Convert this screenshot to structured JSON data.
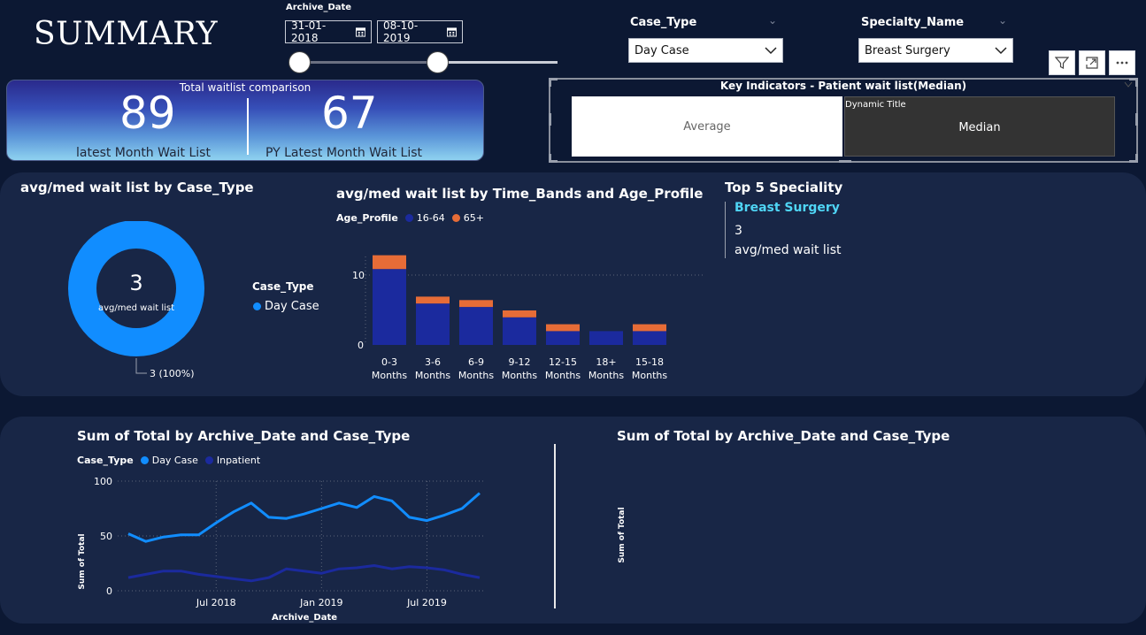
{
  "header": {
    "title": "SUMMARY",
    "archive_date_label": "Archive_Date",
    "date_start": "31-01-2018",
    "date_end": "08-10-2019",
    "case_type_label": "Case_Type",
    "case_type_value": "Day Case",
    "specialty_label": "Specialty_Name",
    "specialty_value": "Breast Surgery"
  },
  "kpi": {
    "title": "Total waitlist comparison",
    "latest_value": "89",
    "latest_label": "latest Month Wait List",
    "py_value": "67",
    "py_label": "PY Latest Month Wait List"
  },
  "key_indicators": {
    "title": "Key Indicators - Patient wait list(Median)",
    "average_label": "Average",
    "dynamic_title": "Dynamic Title",
    "median_label": "Median"
  },
  "donut": {
    "title": "avg/med wait list by Case_Type",
    "center_value": "3",
    "center_label": "avg/med wait list",
    "data_label": "3 (100%)",
    "legend_title": "Case_Type",
    "legend_item": "Day Case",
    "color": "#118dff"
  },
  "bar_chart": {
    "title": "avg/med wait list by Time_Bands and Age_Profile",
    "legend_title": "Age_Profile",
    "tick_0": "0",
    "tick_10": "10"
  },
  "top5": {
    "title": "Top 5 Speciality",
    "item_name": "Breast Surgery",
    "item_value": "3",
    "item_metric": "avg/med wait list"
  },
  "line_chart": {
    "title": "Sum of Total by Archive_Date and Case_Type",
    "legend_title": "Case_Type",
    "ylabel": "Sum of Total",
    "xlabel": "Archive_Date",
    "y_ticks": [
      "100",
      "50",
      "0"
    ],
    "x_ticks": [
      "Jul 2018",
      "Jan 2019",
      "Jul 2019"
    ]
  },
  "line_chart_2": {
    "title": "Sum of Total by Archive_Date and Case_Type",
    "ylabel": "Sum of Total"
  },
  "chart_data": [
    {
      "type": "pie",
      "categories": [
        "Day Case"
      ],
      "values": [
        3
      ],
      "labels": [
        "3 (100%)"
      ]
    },
    {
      "type": "bar",
      "categories": [
        "0-3 Months",
        "3-6 Months",
        "6-9 Months",
        "9-12 Months",
        "12-15 Months",
        "18+ Months",
        "15-18 Months"
      ],
      "series": [
        {
          "name": "16-64",
          "values": [
            11,
            6,
            5.5,
            4,
            2,
            2,
            2
          ],
          "color": "#1b2a9e"
        },
        {
          "name": "65+",
          "values": [
            2,
            1,
            1,
            1,
            1,
            0,
            1
          ],
          "color": "#e66c37"
        }
      ],
      "ylim": [
        0,
        13
      ]
    },
    {
      "type": "line",
      "x": [
        "2018-02",
        "2018-03",
        "2018-04",
        "2018-05",
        "2018-06",
        "2018-07",
        "2018-08",
        "2018-09",
        "2018-10",
        "2018-11",
        "2018-12",
        "2019-01",
        "2019-02",
        "2019-03",
        "2019-04",
        "2019-05",
        "2019-06",
        "2019-07",
        "2019-08",
        "2019-09",
        "2019-10"
      ],
      "series": [
        {
          "name": "Day Case",
          "color": "#118dff",
          "values": [
            52,
            45,
            49,
            51,
            51,
            62,
            72,
            80,
            67,
            66,
            70,
            75,
            80,
            76,
            86,
            82,
            67,
            64,
            69,
            75,
            89
          ]
        },
        {
          "name": "Inpatient",
          "color": "#1b2a9e",
          "values": [
            12,
            15,
            18,
            18,
            15,
            13,
            11,
            9,
            12,
            20,
            18,
            16,
            20,
            21,
            23,
            20,
            22,
            21,
            19,
            15,
            12
          ]
        }
      ],
      "ylim": [
        0,
        100
      ]
    }
  ]
}
